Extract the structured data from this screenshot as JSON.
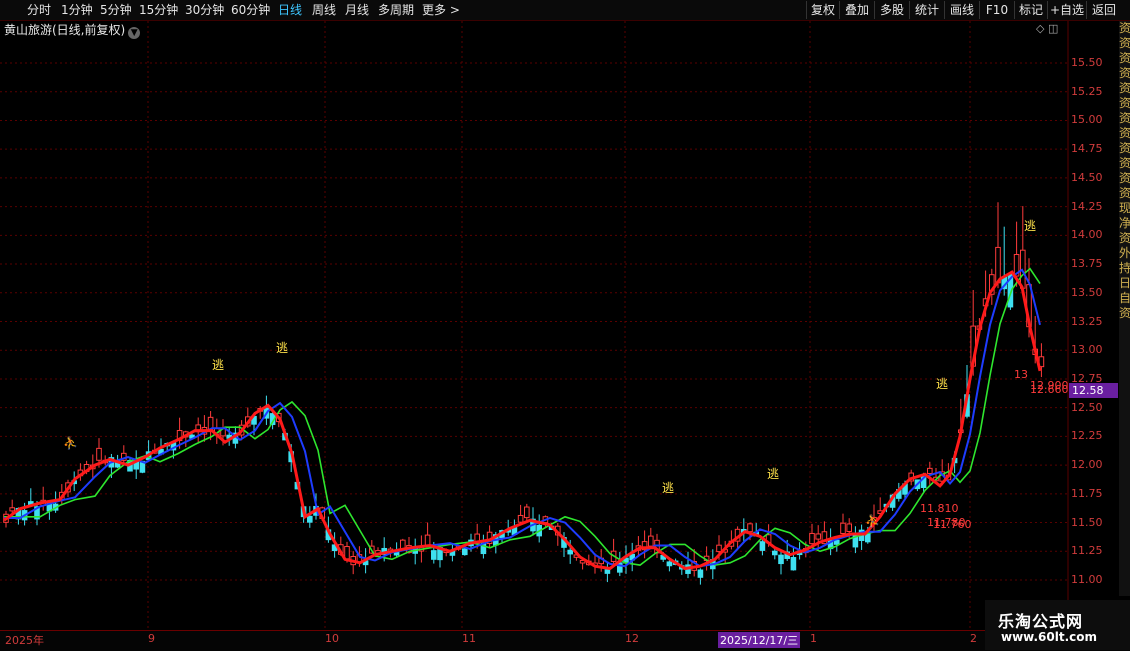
{
  "toolbar": {
    "periods": [
      "分时",
      "1分钟",
      "5分钟",
      "15分钟",
      "30分钟",
      "60分钟",
      "日线",
      "周线",
      "月线",
      "多周期",
      "更多 >"
    ],
    "active_period": "日线",
    "actions": [
      "复权",
      "叠加",
      "多股",
      "统计",
      "画线",
      "F10",
      "标记",
      "+自选",
      "返回"
    ]
  },
  "chart_header": {
    "title": "黄山旅游(日线,前复权)",
    "dropdown_icon": "chevron-down-icon"
  },
  "y_axis": {
    "ticks": [
      "15.50",
      "15.25",
      "15.00",
      "14.75",
      "14.50",
      "14.25",
      "14.00",
      "13.75",
      "13.50",
      "13.25",
      "13.00",
      "12.75",
      "12.50",
      "12.25",
      "12.00",
      "11.75",
      "11.50",
      "11.25",
      "11.00"
    ],
    "current_price": "12.58"
  },
  "date_axis": {
    "labels": [
      "2025年",
      "9",
      "10",
      "11",
      "12",
      "1",
      "2"
    ],
    "cursor_date": "2025/12/17/三"
  },
  "annotations": {
    "escape_label": "逃",
    "buy_icon": "person-arrow-icon",
    "price_labels": [
      "11.810",
      "11.780",
      "11.760",
      "13",
      "12.900",
      "12.660"
    ]
  },
  "right_strip_text": [
    "资",
    "资",
    "资",
    "资",
    "资",
    "资",
    "资",
    "资",
    "资",
    "资",
    "资",
    "资",
    "现",
    "净",
    "资",
    "外",
    "持",
    "日",
    "自",
    "资"
  ],
  "watermark": {
    "line1": "乐淘公式网",
    "line2": "www.60lt.com"
  },
  "colors": {
    "up": "#ff3b3b",
    "down": "#3ee0f0",
    "ma_red": "#ff1a1a",
    "ma_blue": "#1e3cff",
    "ma_green": "#2ee62e",
    "marker_yellow": "#ffe24a",
    "grid": "#5a0000"
  }
}
